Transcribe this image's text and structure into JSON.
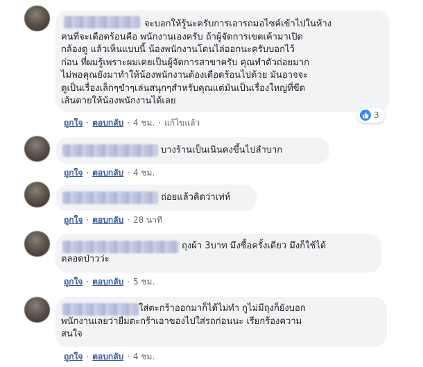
{
  "comments": [
    {
      "text": "จะบอกให้รู้นะครับการเอารถมอไซค์เข้าไปในห้าง\nคนที่จะเดือดร้อนคือ พนักงานเองครับ ถ้าผู้จัดการเขตเค้ามาเปิด\nกล้องดู แล้วเห็นแบบนี้ น้องพนักงานโดนไล่ออกนะครับบอกไว้\nก่อน ที่ผมรู้เพราะผมเคยเป็นผู้จัดการสาขาครับ คุณทำตัวถ่อยมาก\nไม่พอคุณยังมาทำให้น้องพนักงานต้องเดือดร้อนไปด้วย มันอาจจะ\nดูเป็นเรื่องเล็กๆขำๆเล่นสนุกๆสำหรับคุณแต่มันเป็นเรื่องใหญ่ที่ขีด\nเส้นตายให้น้องพนักงานได้เลย",
      "like": "ถูกใจ",
      "reply": "ตอบกลับ",
      "time": "4 ชม.",
      "edited": "แก้ไขแล้ว",
      "reactions": "3"
    },
    {
      "text": "บางร้านเป็นเนินคงขึ้นไปลำบาก",
      "like": "ถูกใจ",
      "reply": "ตอบกลับ",
      "time": "4 ชม."
    },
    {
      "text": "ถ่อยแล้วคิดว่าเท่ห์",
      "like": "ถูกใจ",
      "reply": "ตอบกลับ",
      "time": "28 นาที"
    },
    {
      "text": "ถุงผ้า 3บาท มึงซื้อครั้งเดียว มึงก็ใช้ได้\nตลอดป่าวว่ะ",
      "like": "ถูกใจ",
      "reply": "ตอบกลับ",
      "time": "5 ชม."
    },
    {
      "text": "ใส่ตะกร้าออกมาก็ได้ไม่ทำ กูไม่มีถุงก็ยังบอก\nพนักงานเลยว่ายืมตะกร้าเอาของไปใส่รถก่อนนะ เรียกร้องความ\nสนใจ",
      "like": "ถูกใจ",
      "reply": "ตอบกลับ",
      "time": "4 ชม."
    }
  ],
  "colors": {
    "bubble": "#f2f3f5",
    "link": "#365899",
    "meta": "#606770",
    "like_blue": "#2d88ff"
  },
  "icons": {
    "reaction": "like-icon"
  }
}
